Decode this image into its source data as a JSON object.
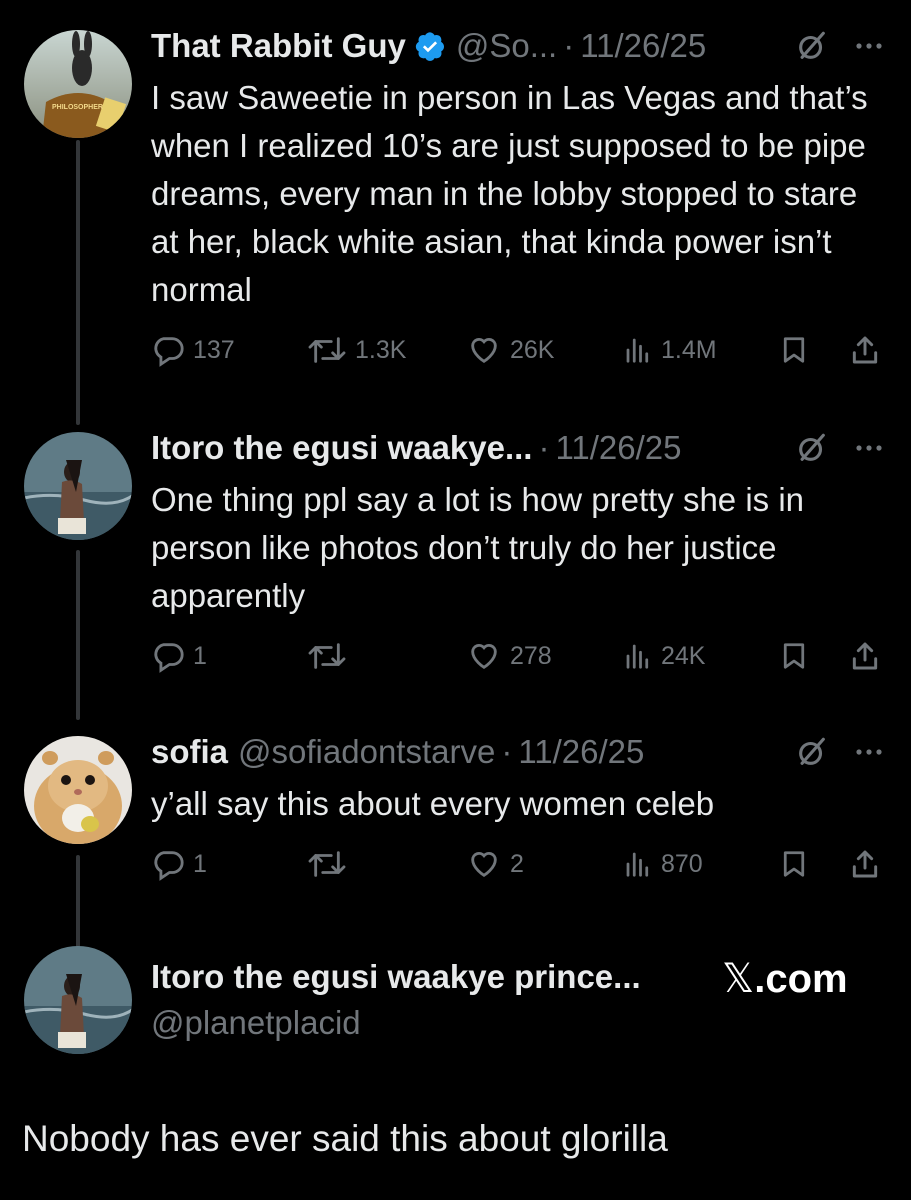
{
  "tweets": [
    {
      "name": "That Rabbit Guy",
      "handle": "@So...",
      "date": "11/26/25",
      "verified": true,
      "avatar_text": "PHILOSOPHER",
      "text": "I saw Saweetie in person in Las Vegas and that’s when I realized 10’s are just supposed to be pipe dreams, every man in the lobby stopped to stare at her, black white asian, that kinda power isn’t normal",
      "replies": "137",
      "reposts": "1.3K",
      "likes": "26K",
      "views": "1.4M"
    },
    {
      "name": "Itoro the egusi waakye...",
      "handle": "",
      "date": "11/26/25",
      "verified": false,
      "text": "One thing ppl say a lot is how pretty she is in person like photos don’t truly do her justice apparently",
      "replies": "1",
      "reposts": "",
      "likes": "278",
      "views": "24K"
    },
    {
      "name": "sofia",
      "handle": "@sofiadontstarve",
      "date": "11/26/25",
      "verified": false,
      "text": "y’all say this about every women celeb",
      "replies": "1",
      "reposts": "",
      "likes": "2",
      "views": "870"
    }
  ],
  "embed": {
    "name": "Itoro the egusi waakye prince...",
    "handle": "@planetplacid",
    "brand": "X.com"
  },
  "caption": "Nobody has ever said this about glorilla",
  "colors": {
    "background": "#000000",
    "text": "#e7e9ea",
    "muted": "#71767b",
    "verified": "#1d9bf0",
    "thread_line": "#333639"
  },
  "icons": [
    "reply-icon",
    "repost-icon",
    "like-icon",
    "views-icon",
    "bookmark-icon",
    "share-icon",
    "grok-icon",
    "more-icon",
    "verified-badge-icon",
    "x-logo-icon"
  ]
}
